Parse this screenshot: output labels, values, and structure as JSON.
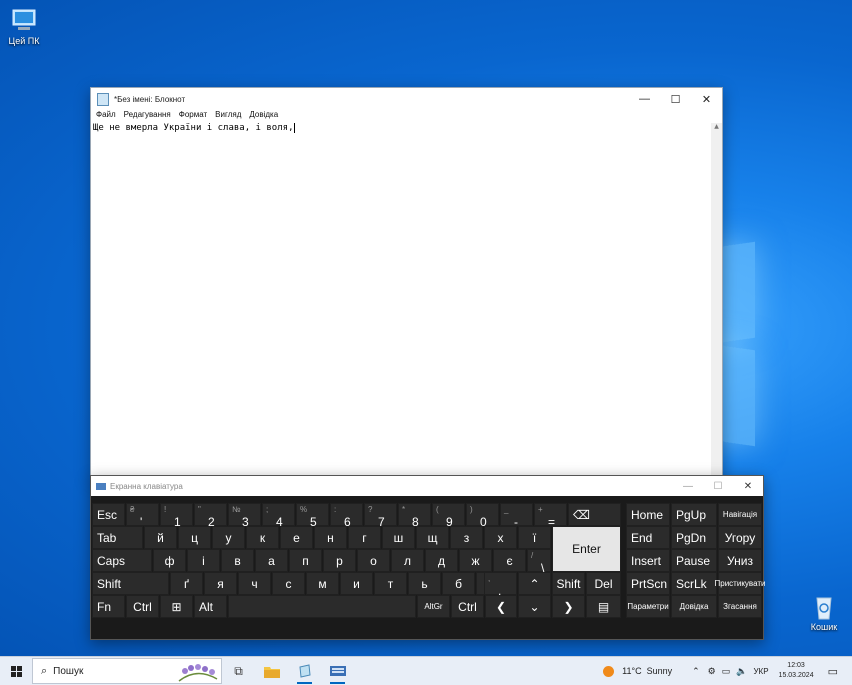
{
  "desktop": {
    "icons": [
      {
        "label": "Цей ПК",
        "icon": "computer-icon"
      },
      {
        "label": "Кошик",
        "icon": "recycle-bin-icon"
      }
    ]
  },
  "notepad": {
    "title": "*Без імені: Блокнот",
    "menu": [
      "Файл",
      "Редагування",
      "Формат",
      "Вигляд",
      "Довідка"
    ],
    "content": "Ще не вмерла України і слава, і воля,"
  },
  "keyboard": {
    "title": "Екранна клавіатура",
    "row1": [
      {
        "shift": "₴",
        "main": "'"
      },
      {
        "shift": "!",
        "main": "1"
      },
      {
        "shift": "\"",
        "main": "2"
      },
      {
        "shift": "№",
        "main": "3"
      },
      {
        "shift": ";",
        "main": "4"
      },
      {
        "shift": "%",
        "main": "5"
      },
      {
        "shift": ":",
        "main": "6"
      },
      {
        "shift": "?",
        "main": "7"
      },
      {
        "shift": "*",
        "main": "8"
      },
      {
        "shift": "(",
        "main": "9"
      },
      {
        "shift": ")",
        "main": "0"
      },
      {
        "shift": "_",
        "main": "-"
      },
      {
        "shift": "+",
        "main": "="
      }
    ],
    "row2": [
      "й",
      "ц",
      "у",
      "к",
      "е",
      "н",
      "г",
      "ш",
      "щ",
      "з",
      "х",
      "ї"
    ],
    "row3": [
      "ф",
      "і",
      "в",
      "а",
      "п",
      "р",
      "о",
      "л",
      "д",
      "ж",
      "є"
    ],
    "row3_extra": {
      "shift": "/",
      "main": "\\"
    },
    "row4": [
      "ґ",
      "я",
      "ч",
      "с",
      "м",
      "и",
      "т",
      "ь",
      "б",
      "ю"
    ],
    "row4_extra": {
      "shift": ",",
      "main": "."
    },
    "labels": {
      "esc": "Esc",
      "backspace": "⌫",
      "tab": "Tab",
      "enter": "Enter",
      "caps": "Caps",
      "shift": "Shift",
      "fn": "Fn",
      "ctrl": "Ctrl",
      "alt": "Alt",
      "altgr": "AltGr",
      "del": "Del",
      "home": "Home",
      "pgup": "PgUp",
      "nav": "Навігація",
      "end": "End",
      "pgdn": "PgDn",
      "up_ua": "Угору",
      "insert": "Insert",
      "pause": "Pause",
      "down_ua": "Униз",
      "prtscn": "PrtScn",
      "scrlk": "ScrLk",
      "dock": "Пристикувати",
      "params": "Параметри",
      "help": "Довідка",
      "fade": "Згасання",
      "arrow_up": "⌃",
      "arrow_down": "⌄",
      "arrow_left": "❮",
      "arrow_right": "❯",
      "menu": "▤"
    }
  },
  "taskbar": {
    "search_placeholder": "Пошук",
    "weather": "11°C  Sunny",
    "language": "УКР",
    "time": "12:03",
    "date": "15.03.2024"
  }
}
